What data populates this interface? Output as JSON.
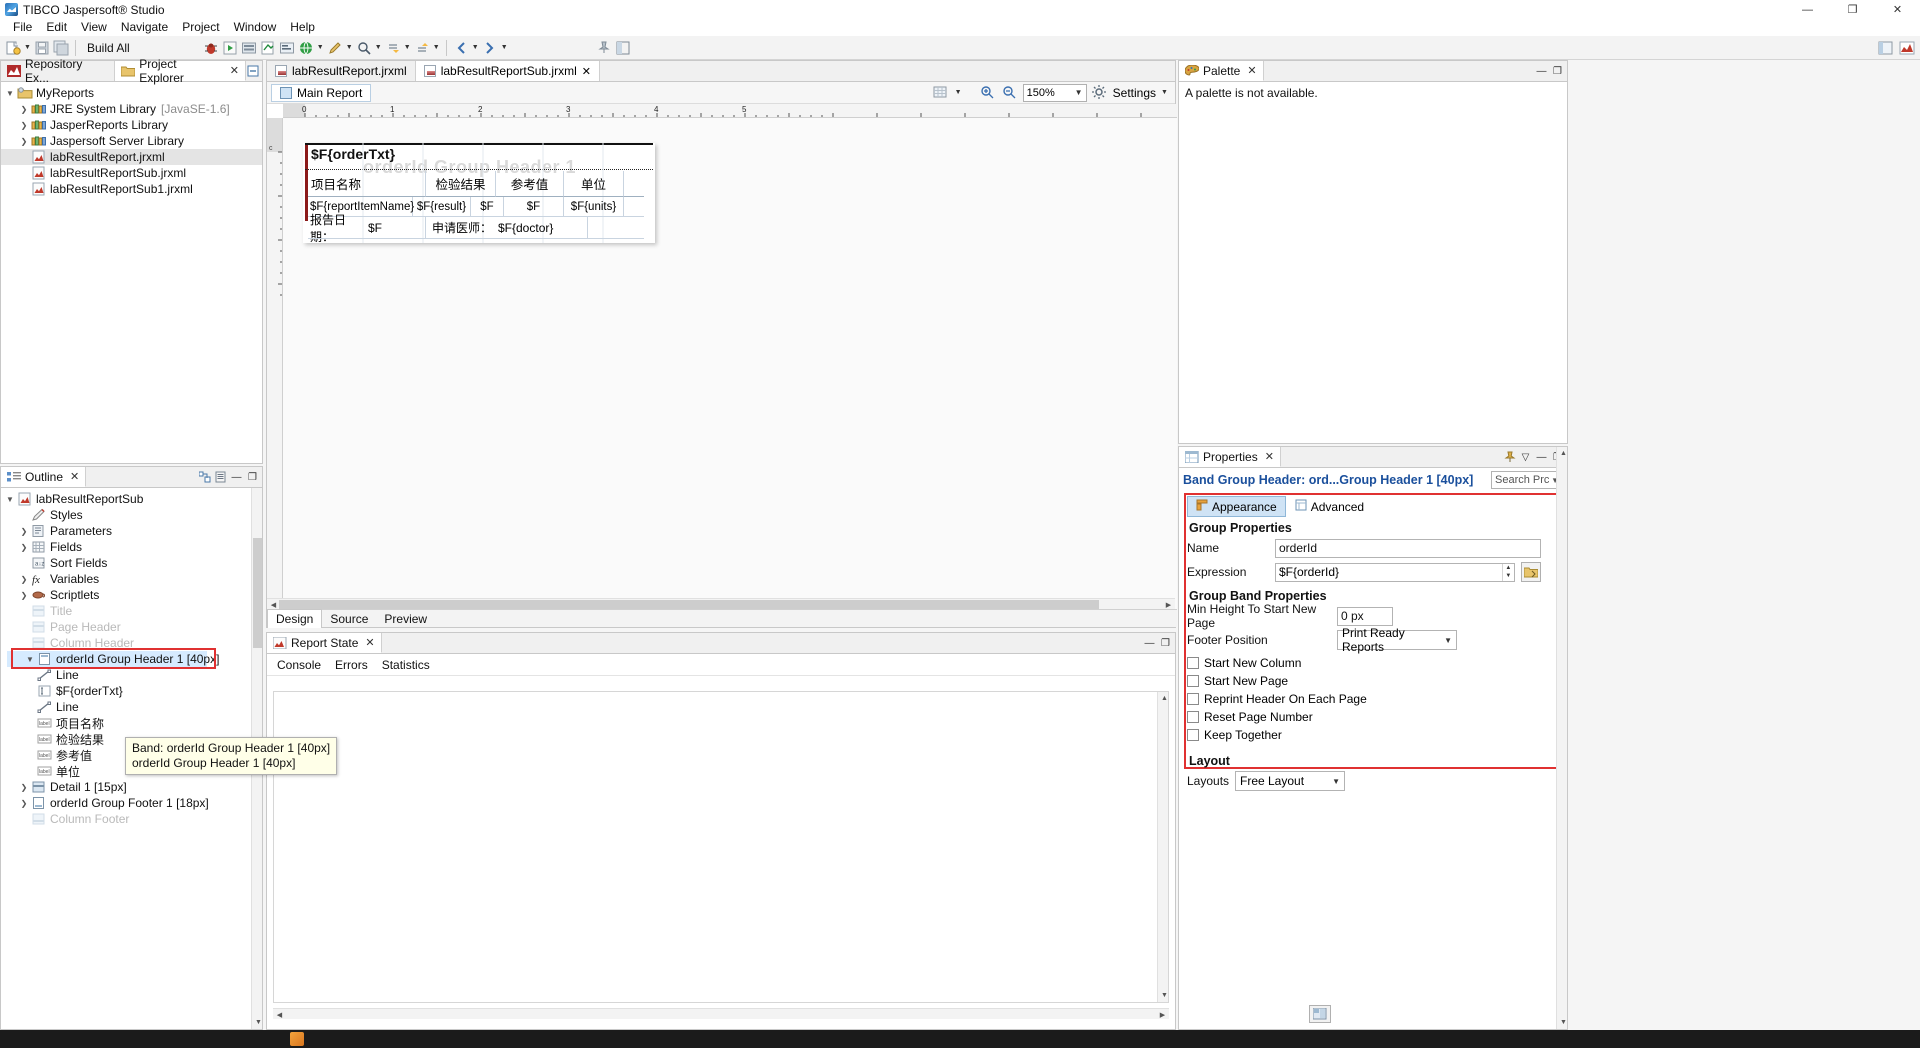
{
  "window": {
    "title": "TIBCO Jaspersoft® Studio",
    "icon": "jaspersoft-logo-icon",
    "minimize": "—",
    "maximize": "❐",
    "close": "✕"
  },
  "menubar": {
    "items": [
      "File",
      "Edit",
      "View",
      "Navigate",
      "Project",
      "Window",
      "Help"
    ]
  },
  "toolbar": {
    "build_label": "Build All",
    "icons": [
      "new-file-icon",
      "save-icon",
      "save-all-icon",
      "debug-icon",
      "run-as-icon",
      "external-tools-icon",
      "compile-icon",
      "preview-icon",
      "jasper-server-icon",
      "edit-icon",
      "search-icon",
      "next-annotation-icon",
      "previous-annotation-icon",
      "back-icon",
      "forward-icon",
      "pin-icon",
      "perspective-icon"
    ],
    "right_icons": [
      "open-perspective-icon",
      "jaspersoft-perspective-icon"
    ]
  },
  "repository_panel": {
    "tabs": [
      {
        "label": "Repository Ex...",
        "icon": "repository-icon",
        "active": false,
        "closable": false
      },
      {
        "label": "Project Explorer",
        "icon": "project-explorer-icon",
        "active": true,
        "closable": true
      }
    ],
    "toolbar_icons": [
      "collapse-all-icon"
    ],
    "tree": [
      {
        "label": "MyReports",
        "icon": "project-icon",
        "indent": 0,
        "arrow": "v",
        "state": "normal"
      },
      {
        "label": "JRE System Library",
        "suffix": "[JavaSE-1.6]",
        "icon": "library-icon",
        "indent": 1,
        "arrow": ">",
        "state": "normal"
      },
      {
        "label": "JasperReports Library",
        "icon": "library-icon",
        "indent": 1,
        "arrow": ">",
        "state": "normal"
      },
      {
        "label": "Jaspersoft Server Library",
        "icon": "library-icon",
        "indent": 1,
        "arrow": ">",
        "state": "normal"
      },
      {
        "label": "labResultReport.jrxml",
        "icon": "jrxml-file-icon",
        "indent": 1,
        "arrow": "",
        "state": "selected-gray"
      },
      {
        "label": "labResultReportSub.jrxml",
        "icon": "jrxml-file-icon",
        "indent": 1,
        "arrow": "",
        "state": "normal"
      },
      {
        "label": "labResultReportSub1.jrxml",
        "icon": "jrxml-file-icon",
        "indent": 1,
        "arrow": "",
        "state": "normal"
      }
    ]
  },
  "outline_panel": {
    "tab_label": "Outline",
    "tab_icon": "outline-icon",
    "toolbar_icons": [
      "link-with-editor-icon",
      "view-menu-icon"
    ],
    "minimize": "—",
    "maximize": "❐",
    "tree": [
      {
        "label": "labResultReportSub",
        "icon": "jrxml-file-icon",
        "indent": 0,
        "arrow": "v",
        "state": "normal"
      },
      {
        "label": "Styles",
        "icon": "styles-pencil-icon",
        "indent": 1,
        "arrow": "",
        "state": "normal"
      },
      {
        "label": "Parameters",
        "icon": "parameters-icon",
        "indent": 1,
        "arrow": ">",
        "state": "normal"
      },
      {
        "label": "Fields",
        "icon": "fields-icon",
        "indent": 1,
        "arrow": ">",
        "state": "normal"
      },
      {
        "label": "Sort Fields",
        "icon": "sort-fields-icon",
        "indent": 1,
        "arrow": "",
        "state": "normal"
      },
      {
        "label": "Variables",
        "icon": "variables-fx-icon",
        "indent": 1,
        "arrow": ">",
        "state": "normal"
      },
      {
        "label": "Scriptlets",
        "icon": "scriptlets-cup-icon",
        "indent": 1,
        "arrow": ">",
        "state": "normal"
      },
      {
        "label": "Title",
        "icon": "band-icon",
        "indent": 1,
        "arrow": "",
        "state": "disabled"
      },
      {
        "label": "Page Header",
        "icon": "band-icon",
        "indent": 1,
        "arrow": "",
        "state": "disabled"
      },
      {
        "label": "Column Header",
        "icon": "band-icon",
        "indent": 1,
        "arrow": "",
        "state": "disabled"
      },
      {
        "label": "orderId Group Header 1 [40px]",
        "icon": "group-band-icon",
        "indent": 1,
        "arrow": "v",
        "state": "selected-highlight"
      },
      {
        "label": "Line",
        "icon": "line-element-icon",
        "indent": 2,
        "arrow": "",
        "state": "normal"
      },
      {
        "label": "$F{orderTxt}",
        "icon": "textfield-element-icon",
        "indent": 2,
        "arrow": "",
        "state": "normal"
      },
      {
        "label": "Line",
        "icon": "line-element-icon",
        "indent": 2,
        "arrow": "",
        "state": "normal"
      },
      {
        "label": "项目名称",
        "icon": "static-text-icon",
        "indent": 2,
        "arrow": "",
        "state": "normal"
      },
      {
        "label": "检验结果",
        "icon": "static-text-icon",
        "indent": 2,
        "arrow": "",
        "state": "normal"
      },
      {
        "label": "参考值",
        "icon": "static-text-icon",
        "indent": 2,
        "arrow": "",
        "state": "normal"
      },
      {
        "label": "单位",
        "icon": "static-text-icon",
        "indent": 2,
        "arrow": "",
        "state": "normal"
      },
      {
        "label": "Detail 1 [15px]",
        "icon": "band-icon",
        "indent": 1,
        "arrow": ">",
        "state": "normal"
      },
      {
        "label": "orderId Group Footer 1 [18px]",
        "icon": "group-band-icon",
        "indent": 1,
        "arrow": ">",
        "state": "normal"
      },
      {
        "label": "Column Footer",
        "icon": "band-icon",
        "indent": 1,
        "arrow": "",
        "state": "disabled"
      }
    ],
    "tooltip": {
      "line1": "Band: orderId Group Header 1 [40px]",
      "line2": "orderId Group Header 1 [40px]"
    }
  },
  "editor": {
    "tabs": [
      {
        "label": "labResultReport.jrxml",
        "active": false,
        "closable": false
      },
      {
        "label": "labResultReportSub.jrxml",
        "active": true,
        "closable": true
      }
    ],
    "main_report_chip": "Main Report",
    "zoom": "150%",
    "settings_label": "Settings",
    "bottom_tabs": [
      {
        "label": "Design",
        "active": true
      },
      {
        "label": "Source",
        "active": false
      },
      {
        "label": "Preview",
        "active": false
      }
    ],
    "ruler_h_ticks": [
      "0",
      "1",
      "2",
      "3",
      "4",
      "5"
    ],
    "band_watermark": "orderId Group Header 1",
    "report": {
      "title_field": "$F{orderTxt}",
      "header_row": [
        "项目名称",
        "检验结果",
        "参考值",
        "单位"
      ],
      "detail_row": [
        "$F{reportItemName}",
        "$F{result}",
        "$F",
        "$F",
        "$F{units}"
      ],
      "footer_row": {
        "date_label": "报告日期：",
        "date_value": "$F",
        "doctor_label": "申请医师：",
        "doctor_value": "$F{doctor}"
      }
    }
  },
  "console_panel": {
    "tab_label": "Report State",
    "tab_icon": "report-state-icon",
    "minimize": "—",
    "maximize": "❐",
    "inner_tabs": [
      {
        "label": "Console",
        "active": true
      },
      {
        "label": "Errors",
        "active": false
      },
      {
        "label": "Statistics",
        "active": false
      }
    ],
    "content": ""
  },
  "palette_panel": {
    "tab_label": "Palette",
    "tab_icon": "palette-icon",
    "minimize": "—",
    "maximize": "❐",
    "empty_message": "A palette is not available."
  },
  "properties_panel": {
    "tab_label": "Properties",
    "tab_icon": "properties-icon",
    "toolbar_icons": [
      "pin-icon",
      "view-menu-icon"
    ],
    "minimize": "—",
    "maximize": "❐",
    "header_title": "Band Group Header: ord...Group Header 1 [40px]",
    "search_placeholder": "Search Prc",
    "tabs": [
      {
        "label": "Appearance",
        "icon": "appearance-icon",
        "active": true
      },
      {
        "label": "Advanced",
        "icon": "advanced-icon",
        "active": false
      }
    ],
    "group_properties": {
      "section_title": "Group Properties",
      "name_label": "Name",
      "name_value": "orderId",
      "expression_label": "Expression",
      "expression_value": "$F{orderId}",
      "expression_button_icon": "expression-editor-icon"
    },
    "group_band_properties": {
      "section_title": "Group Band Properties",
      "min_height_label": "Min Height To Start New Page",
      "min_height_value": "0 px",
      "footer_position_label": "Footer Position",
      "footer_position_value": "Print Ready Reports",
      "checkboxes": [
        {
          "label": "Start New Column",
          "checked": false
        },
        {
          "label": "Start New Page",
          "checked": false
        },
        {
          "label": "Reprint Header On Each Page",
          "checked": false
        },
        {
          "label": "Reset Page Number",
          "checked": false
        },
        {
          "label": "Keep Together",
          "checked": false
        }
      ]
    },
    "layout": {
      "section_title": "Layout",
      "layouts_label": "Layouts",
      "layouts_value": "Free Layout"
    },
    "footer_icon": "layout-preview-icon"
  },
  "colors": {
    "accent_blue": "#1a4f9c",
    "highlight_red": "#e03131",
    "selection_blue": "#d6ebff",
    "tab_active": "#ffffff"
  }
}
